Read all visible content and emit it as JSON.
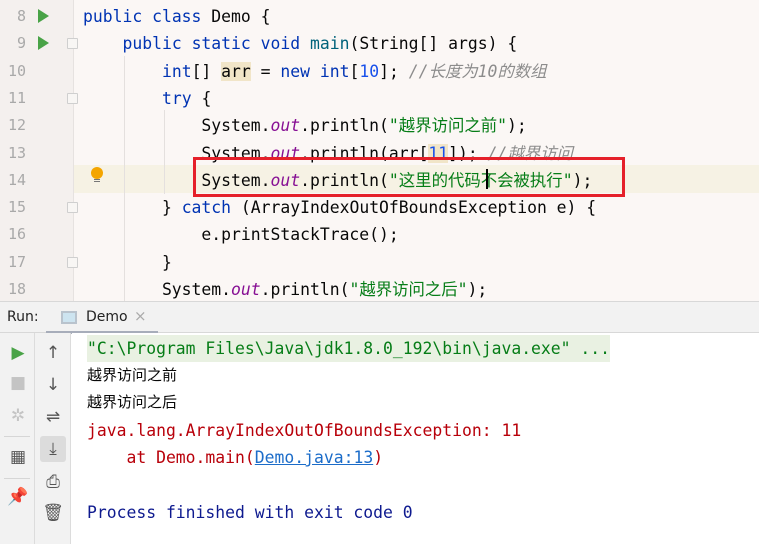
{
  "editor": {
    "lines": [
      {
        "num": "8",
        "run": true,
        "fold": false,
        "tokens": [
          [
            "public ",
            "kw"
          ],
          [
            "class ",
            "kw"
          ],
          [
            "Demo {",
            ""
          ]
        ]
      },
      {
        "num": "9",
        "run": true,
        "fold": true,
        "tokens": [
          [
            "    ",
            ""
          ],
          [
            "public ",
            "kw"
          ],
          [
            "static ",
            "kw"
          ],
          [
            "void ",
            "kw"
          ],
          [
            "main",
            "fn"
          ],
          [
            "(String[] args) {",
            ""
          ]
        ]
      },
      {
        "num": "10",
        "run": false,
        "fold": false,
        "tokens": [
          [
            "        ",
            ""
          ],
          [
            "int",
            "kw"
          ],
          [
            "[] ",
            ""
          ],
          [
            "arr",
            "hl"
          ],
          [
            " = ",
            ""
          ],
          [
            "new ",
            "kw"
          ],
          [
            "int",
            "kw"
          ],
          [
            "[",
            ""
          ],
          [
            "10",
            "num"
          ],
          [
            "]; ",
            ""
          ],
          [
            "//长度为10的数组",
            "cm"
          ]
        ]
      },
      {
        "num": "11",
        "run": false,
        "fold": true,
        "tokens": [
          [
            "        ",
            ""
          ],
          [
            "try ",
            "kw"
          ],
          [
            "{",
            ""
          ]
        ]
      },
      {
        "num": "12",
        "run": false,
        "fold": false,
        "tokens": [
          [
            "            System.",
            ""
          ],
          [
            "out",
            "sf"
          ],
          [
            ".println(",
            ""
          ],
          [
            "\"越界访问之前\"",
            "st"
          ],
          [
            ");",
            ""
          ]
        ]
      },
      {
        "num": "13",
        "run": false,
        "fold": false,
        "tokens": [
          [
            "            System.",
            ""
          ],
          [
            "out",
            "sf"
          ],
          [
            ".println(arr[",
            ""
          ],
          [
            "11",
            "num hl"
          ],
          [
            "]); ",
            ""
          ],
          [
            "//越界访问",
            "cm"
          ]
        ]
      },
      {
        "num": "14",
        "run": false,
        "fold": false,
        "tokens": [
          [
            "            System.",
            ""
          ],
          [
            "out",
            "sf"
          ],
          [
            ".println(",
            ""
          ],
          [
            "\"这里的代码不会被执行\"",
            "st"
          ],
          [
            ");",
            ""
          ]
        ]
      },
      {
        "num": "15",
        "run": false,
        "fold": true,
        "tokens": [
          [
            "        } ",
            ""
          ],
          [
            "catch ",
            "kw"
          ],
          [
            "(ArrayIndexOutOfBoundsException e) {",
            ""
          ]
        ]
      },
      {
        "num": "16",
        "run": false,
        "fold": false,
        "tokens": [
          [
            "            e.printStackTrace();",
            ""
          ]
        ]
      },
      {
        "num": "17",
        "run": false,
        "fold": true,
        "tokens": [
          [
            "        }",
            ""
          ]
        ]
      },
      {
        "num": "18",
        "run": false,
        "fold": false,
        "tokens": [
          [
            "        System.",
            ""
          ],
          [
            "out",
            "sf"
          ],
          [
            ".println(",
            ""
          ],
          [
            "\"越界访问之后\"",
            "st"
          ],
          [
            ");",
            ""
          ]
        ]
      }
    ]
  },
  "run_panel": {
    "label": "Run:",
    "tab": "Demo",
    "close_icon": "×",
    "toolbar_left": [
      "run-icon",
      "stop-icon",
      "debug-rerun-icon",
      "layout-icon",
      "pin-icon"
    ],
    "toolbar_right": [
      "up-arrow-icon",
      "down-arrow-icon",
      "soft-wrap-icon",
      "scroll-to-end-icon",
      "print-icon",
      "trash-icon"
    ]
  },
  "console": {
    "command": "\"C:\\Program Files\\Java\\jdk1.8.0_192\\bin\\java.exe\" ...",
    "out1": "越界访问之前",
    "out2": "越界访问之后",
    "exception": "java.lang.ArrayIndexOutOfBoundsException: 11",
    "at_prefix": "    at Demo.main(",
    "at_link": "Demo.java:13",
    "at_suffix": ")",
    "exit": "Process finished with exit code 0"
  },
  "colors": {
    "keyword": "#0033b3",
    "string": "#067d17",
    "error": "#b8000a",
    "highlight_box": "#e5202a",
    "run_green": "#49a347"
  }
}
